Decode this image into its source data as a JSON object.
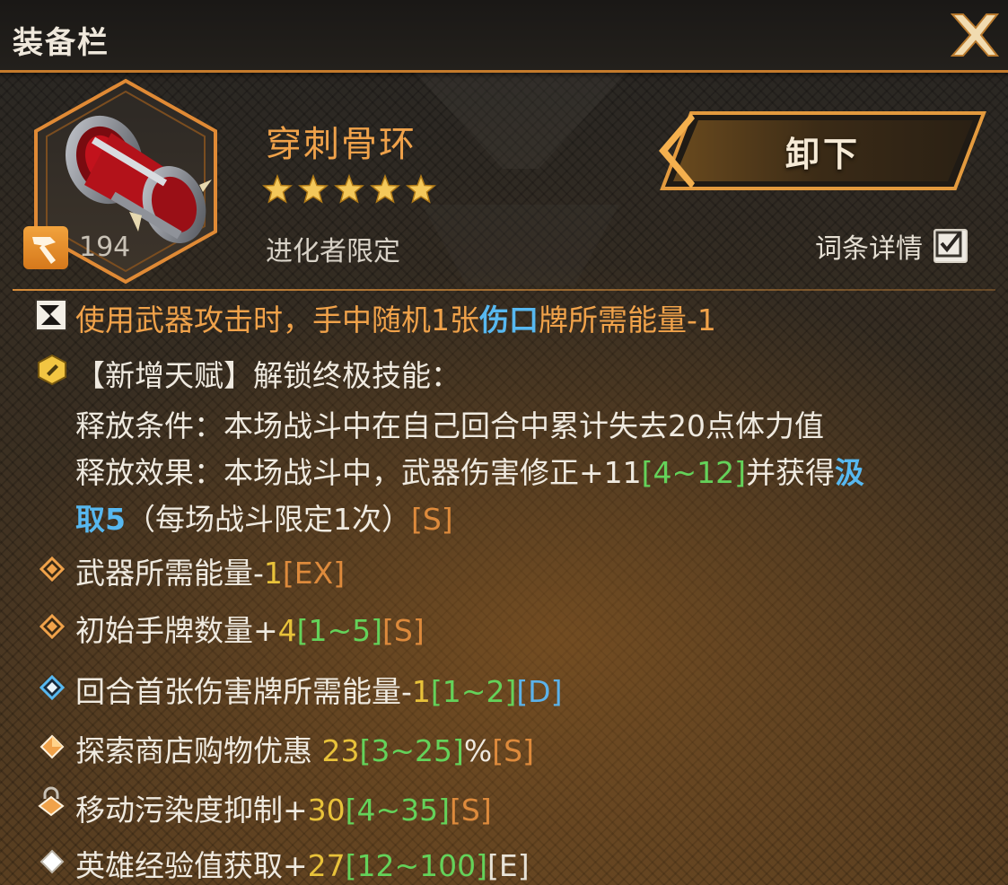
{
  "window": {
    "title": "装备栏"
  },
  "item": {
    "name": "穿刺骨环",
    "stars": 5,
    "level": "194",
    "restriction": "进化者限定"
  },
  "actions": {
    "unequip_label": "卸下",
    "affix_details_label": "词条详情",
    "affix_details_checked": true
  },
  "effects": {
    "main": {
      "part1": "使用武器攻击时，手中随机1张",
      "keyword": "伤口",
      "part2": "牌所需能量-1"
    },
    "talent": {
      "heading": "【新增天赋】解锁终极技能：",
      "condition": "释放条件：本场战斗中在自己回合中累计失去20点体力值",
      "effect_prefix": "释放效果：本场战斗中，武器伤害修正+11",
      "effect_range": "[4~12]",
      "effect_mid": "并获得",
      "effect_keyword_a": "汲",
      "effect_keyword_b": "取5",
      "effect_suffix": "（每场战斗限定1次）",
      "tier": "[S]"
    }
  },
  "affixes": [
    {
      "label": "武器所需能量",
      "sign": "-",
      "value": "1",
      "range": "",
      "tier": "[EX]",
      "icon": "diamond-orange-icon"
    },
    {
      "label": "初始手牌数量",
      "sign": "+",
      "value": "4",
      "range": "[1~5]",
      "tier": "[S]",
      "icon": "diamond-orange-icon"
    },
    {
      "label": "回合首张伤害牌所需能量",
      "sign": "-",
      "value": "1",
      "range": "[1~2]",
      "tier": "[D]",
      "icon": "diamond-blue-icon"
    },
    {
      "label": "探索商店购物优惠 ",
      "sign": "",
      "value": "23",
      "range": "[3~25]",
      "unit": "%",
      "tier": "[S]",
      "icon": "diamond-filled-orange-icon"
    },
    {
      "label": "移动污染度抑制",
      "sign": "+",
      "value": "30",
      "range": "[4~35]",
      "tier": "[S]",
      "icon": "lock-icon"
    },
    {
      "label": "英雄经验值获取",
      "sign": "+",
      "value": "27",
      "range": "[12~100]",
      "tier": "[E]",
      "icon": "diamond-white-icon"
    }
  ],
  "colors": {
    "accent": "#f0a24a",
    "keyword_blue": "#57b8f0",
    "range_green": "#64d25a",
    "value_yellow": "#e8c23a"
  }
}
